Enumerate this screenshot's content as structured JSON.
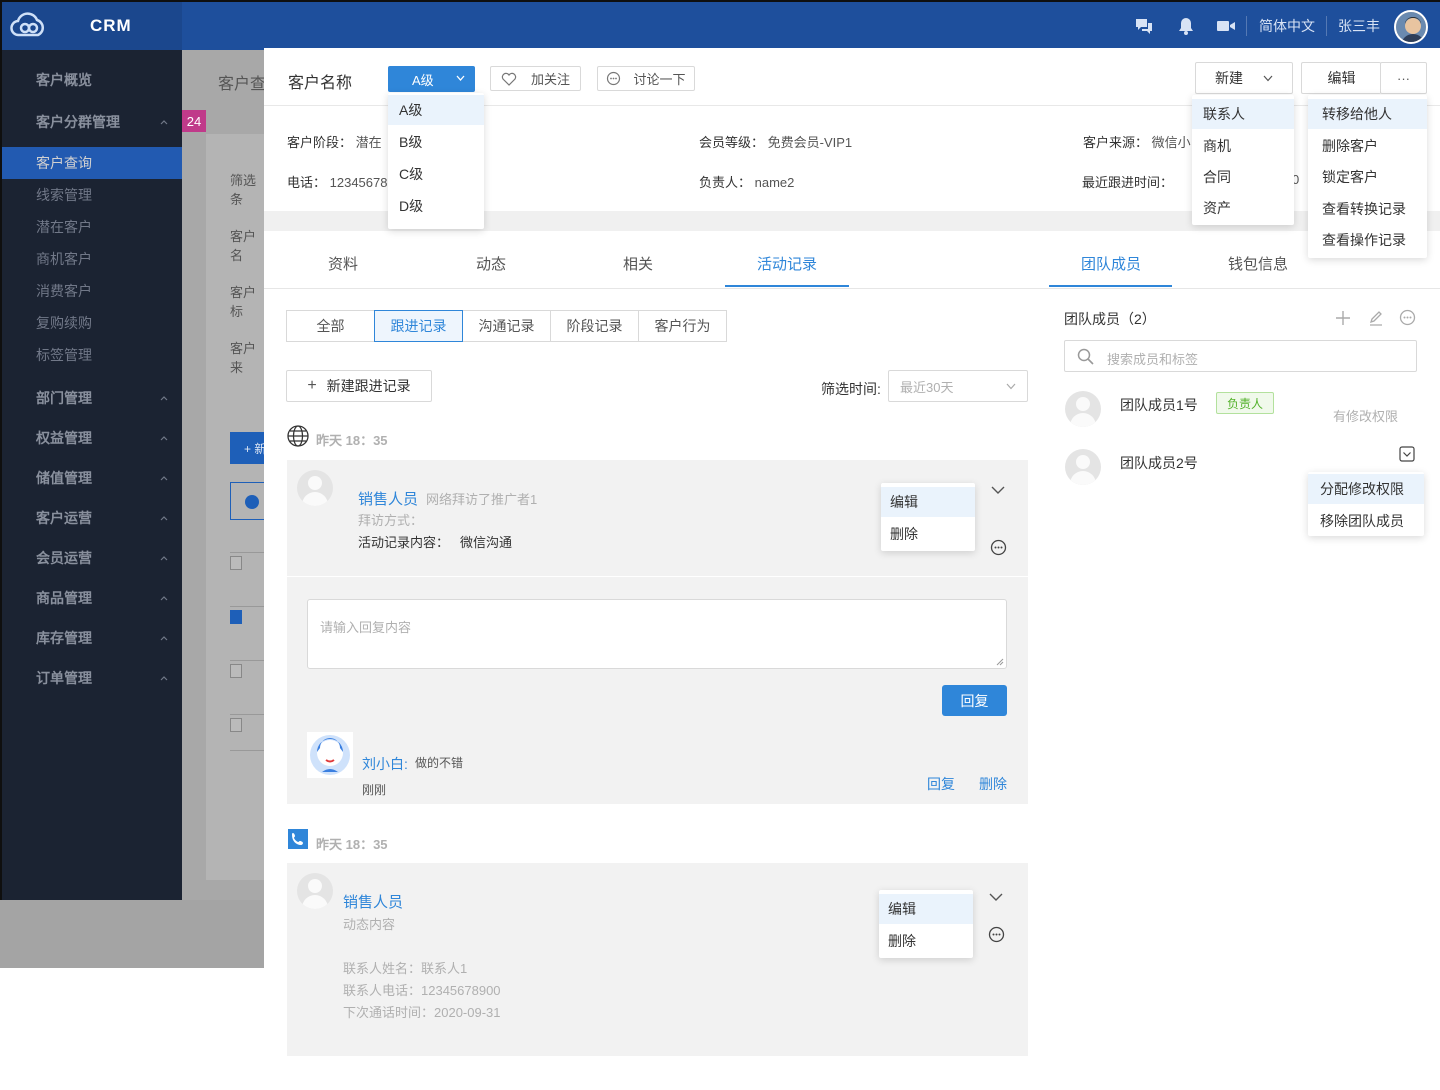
{
  "app": {
    "brand": "CRM",
    "language": "简体中文",
    "user": "张三丰"
  },
  "sidebar": {
    "items": [
      {
        "label": "客户概览",
        "type": "group"
      },
      {
        "label": "客户分群管理",
        "type": "group"
      },
      {
        "label": "客户查询",
        "type": "sub",
        "active": true
      },
      {
        "label": "线索管理",
        "type": "sub"
      },
      {
        "label": "潜在客户",
        "type": "sub"
      },
      {
        "label": "商机客户",
        "type": "sub"
      },
      {
        "label": "消费客户",
        "type": "sub"
      },
      {
        "label": "复购续购",
        "type": "sub"
      },
      {
        "label": "标签管理",
        "type": "sub"
      },
      {
        "label": "部门管理",
        "type": "group"
      },
      {
        "label": "权益管理",
        "type": "group"
      },
      {
        "label": "储值管理",
        "type": "group"
      },
      {
        "label": "客户运营",
        "type": "group"
      },
      {
        "label": "会员运营",
        "type": "group"
      },
      {
        "label": "商品管理",
        "type": "group"
      },
      {
        "label": "库存管理",
        "type": "group"
      },
      {
        "label": "订单管理",
        "type": "group"
      }
    ]
  },
  "background": {
    "page_title": "客户查",
    "badge": "24",
    "filter_label": "筛选条",
    "row_labels": [
      "客户名",
      "客户标",
      "客户来"
    ],
    "add_button": "+ 新"
  },
  "drawer": {
    "title": "客户名称",
    "level_select": "A级",
    "level_options": [
      "A级",
      "B级",
      "C级",
      "D级"
    ],
    "follow_button": "加关注",
    "discuss_button": "讨论一下",
    "new_button": "新建",
    "new_menu": [
      "联系人",
      "商机",
      "合同",
      "资产"
    ],
    "edit_button": "编辑",
    "more_button": "···",
    "more_menu": [
      "转移给他人",
      "删除客户",
      "锁定客户",
      "查看转换记录",
      "查看操作记录"
    ],
    "info": {
      "stage_label": "客户阶段：",
      "stage_value": "潜在",
      "member_label": "会员等级：",
      "member_value": "免费会员-VIP1",
      "source_label": "客户来源：",
      "source_value": "微信小",
      "phone_label": "电话：",
      "phone_value": "12345678",
      "owner_label": "负责人：",
      "owner_value": "name2",
      "recent_label": "最近跟进时间：",
      "recent_value": "0"
    },
    "tabs": [
      "资料",
      "动态",
      "相关",
      "活动记录"
    ],
    "right_tabs": [
      "团队成员",
      "钱包信息"
    ],
    "subtabs": [
      "全部",
      "跟进记录",
      "沟通记录",
      "阶段记录",
      "客户行为"
    ],
    "new_record_button": "新建跟进记录",
    "filter_time_label": "筛选时间:",
    "filter_time_placeholder": "最近30天",
    "record1": {
      "time": "昨天 18：35",
      "person": "销售人员",
      "desc": "网络拜访了推广者1",
      "visit_method": "拜访方式：",
      "content_label": "活动记录内容：",
      "content_value": "微信沟通",
      "menu": [
        "编辑",
        "删除"
      ],
      "reply_placeholder": "请输入回复内容",
      "reply_button": "回复",
      "comment": {
        "author": "刘小白:",
        "text": "做的不错",
        "time": "刚刚",
        "reply": "回复",
        "delete": "删除"
      }
    },
    "record2": {
      "time": "昨天 18：35",
      "person": "销售人员",
      "desc": "动态内容",
      "contact_name": "联系人姓名：联系人1",
      "contact_phone": "联系人电话：12345678900",
      "next_call": "下次通话时间：2020-09-31",
      "menu": [
        "编辑",
        "删除"
      ]
    },
    "team": {
      "title": "团队成员（2）",
      "search_placeholder": "搜索成员和标签",
      "members": [
        {
          "name": "团队成员1号",
          "tag": "负责人",
          "right_text": "有修改权限"
        },
        {
          "name": "团队成员2号"
        }
      ],
      "member_menu": [
        "分配修改权限",
        "移除团队成员"
      ]
    }
  }
}
